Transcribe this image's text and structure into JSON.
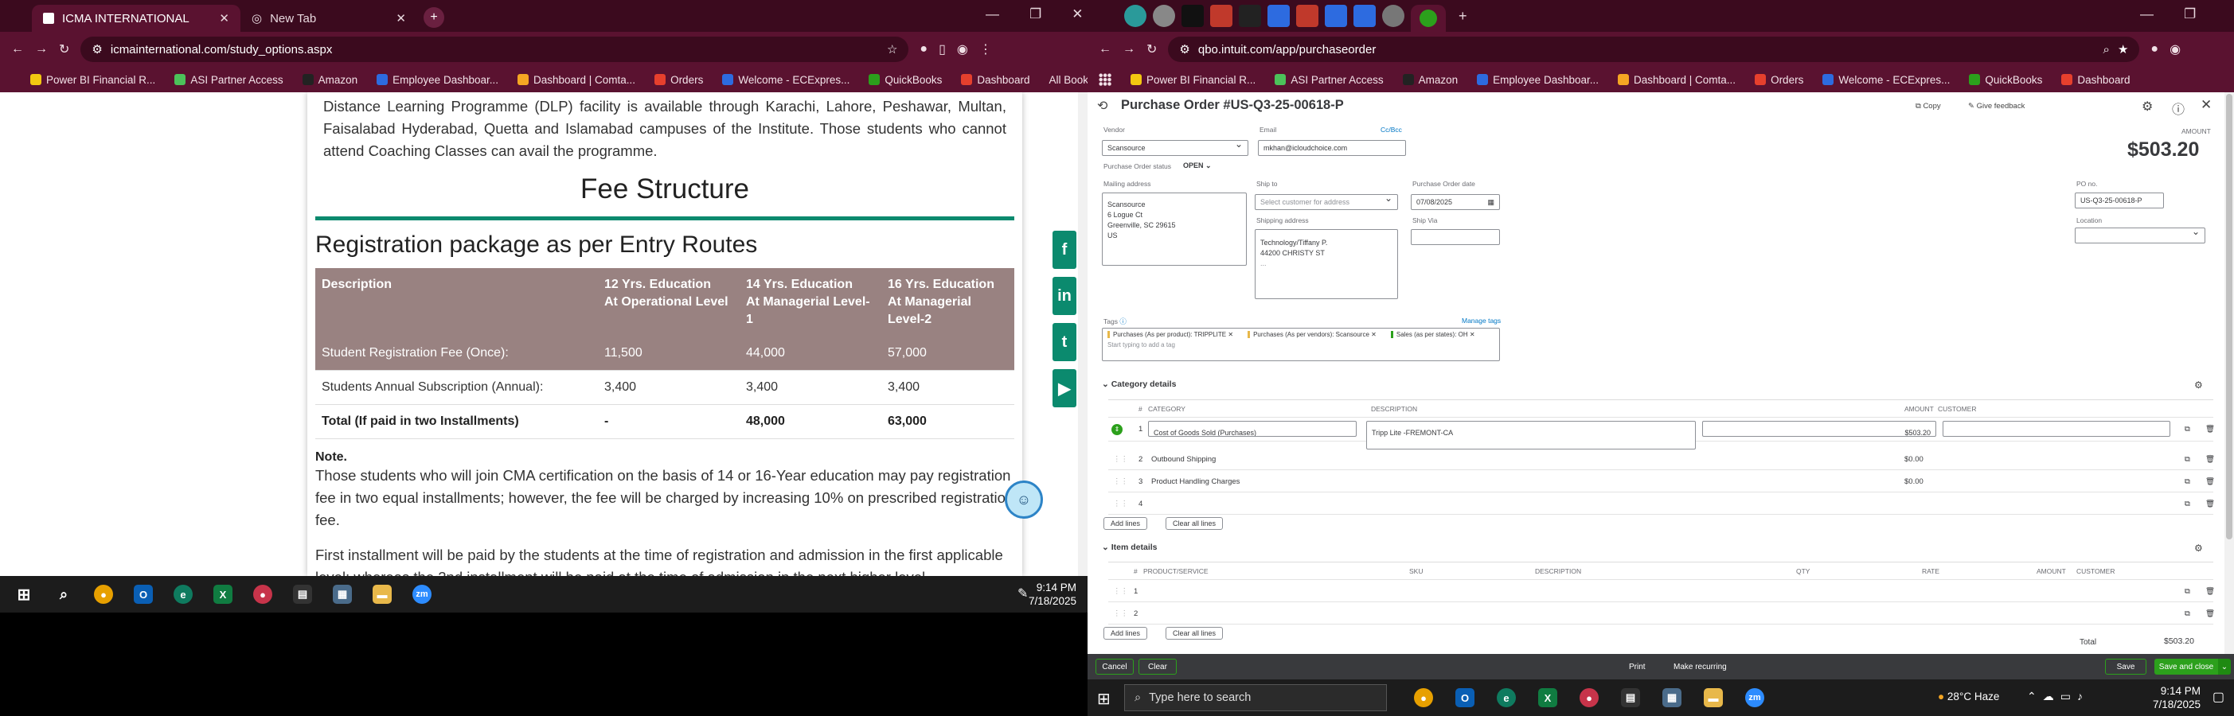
{
  "left_browser": {
    "tabs": [
      {
        "label": "ICMA INTERNATIONAL",
        "active": true
      },
      {
        "label": "New Tab",
        "active": false
      }
    ],
    "url": "icmainternational.com/study_options.aspx",
    "bookmarks": [
      "Power BI Financial R...",
      "ASI Partner Access",
      "Amazon",
      "Employee Dashboar...",
      "Dashboard | Comta...",
      "Orders",
      "Welcome - ECExpres...",
      "QuickBooks",
      "Dashboard"
    ],
    "all_bookmarks": "All Bookmarks",
    "page": {
      "intro": "Distance Learning Programme (DLP) facility is available through Karachi, Lahore, Peshawar, Multan, Faisalabad Hyderabad, Quetta and Islamabad campuses of the Institute. Those students who cannot attend Coaching Classes can avail the programme.",
      "fee_title": "Fee Structure",
      "reg_title": "Registration package as per Entry Routes",
      "table": {
        "headers": [
          [
            "Description",
            ""
          ],
          [
            "12 Yrs. Education",
            "At Operational Level"
          ],
          [
            "14 Yrs. Education",
            "At Managerial Level-1"
          ],
          [
            "16 Yrs. Education",
            "At Managerial Level-2"
          ]
        ],
        "rows": [
          [
            "Student Registration Fee (Once):",
            "11,500",
            "44,000",
            "57,000"
          ],
          [
            "Students Annual Subscription (Annual):",
            "3,400",
            "3,400",
            "3,400"
          ],
          [
            "Total (If paid in two Installments)",
            "-",
            "48,000",
            "63,000"
          ]
        ]
      },
      "note_label": "Note.",
      "note1": "Those students who will join CMA certification on the basis of 14 or 16-Year education may pay registration fee in two equal installments; however, the fee will be charged by increasing 10% on prescribed registration fee.",
      "note2": "First installment will be paid by the students at the time of registration and admission in the first applicable level; whereas the 2nd installment will be paid at the time of admission in the next higher level."
    },
    "taskbar": {
      "time": "9:14 PM",
      "date": "7/18/2025"
    }
  },
  "right_browser": {
    "url": "qbo.intuit.com/app/purchaseorder",
    "bookmarks": [
      "Power BI Financial R...",
      "ASI Partner Access",
      "Amazon",
      "Employee Dashboar...",
      "Dashboard | Comta...",
      "Orders",
      "Welcome - ECExpres...",
      "QuickBooks",
      "Dashboard"
    ],
    "po": {
      "title": "Purchase Order #US-Q3-25-00618-P",
      "copy": "Copy",
      "feedback": "Give feedback",
      "vendor_label": "Vendor",
      "vendor": "Scansource",
      "email_label": "Email",
      "email": "mkhan@icloudchoice.com",
      "ccbcc": "Cc/Bcc",
      "status_label": "Purchase Order status",
      "status": "OPEN",
      "amount_label": "AMOUNT",
      "amount": "$503.20",
      "mailing_label": "Mailing address",
      "mailing": [
        "Scansource",
        "6 Logue Ct",
        "Greenville, SC 29615",
        "US"
      ],
      "shipto_label": "Ship to",
      "shipto_placeholder": "Select customer for address",
      "shipping_label": "Shipping address",
      "shipping": [
        "Technology/Tiffany P.",
        "44200 CHRISTY ST",
        "..."
      ],
      "podate_label": "Purchase Order date",
      "podate": "07/08/2025",
      "shipvia_label": "Ship Via",
      "pono_label": "PO no.",
      "pono": "US-Q3-25-00618-P",
      "location_label": "Location",
      "tags_label": "Tags",
      "manage_tags": "Manage tags",
      "tags": [
        "Purchases (As per product): TRIPPLITE",
        "Purchases (As per vendors): Scansource",
        "Sales (as per states): OH"
      ],
      "tag_placeholder": "Start typing to add a tag",
      "category_header": "Category details",
      "cat_cols": [
        "#",
        "CATEGORY",
        "DESCRIPTION",
        "AMOUNT",
        "CUSTOMER"
      ],
      "cat_rows": [
        {
          "n": "1",
          "category": "Cost of Goods Sold (Purchases)",
          "desc": "Tripp Lite -FREMONT-CA",
          "amount": "$503.20"
        },
        {
          "n": "2",
          "category": "Outbound Shipping",
          "desc": "",
          "amount": "$0.00"
        },
        {
          "n": "3",
          "category": "Product Handling Charges",
          "desc": "",
          "amount": "$0.00"
        },
        {
          "n": "4",
          "category": "",
          "desc": "",
          "amount": ""
        }
      ],
      "add_lines": "Add lines",
      "clear_lines": "Clear all lines",
      "item_header": "Item details",
      "item_cols": [
        "#",
        "PRODUCT/SERVICE",
        "SKU",
        "DESCRIPTION",
        "QTY",
        "RATE",
        "AMOUNT",
        "CUSTOMER"
      ],
      "item_rows": [
        "1",
        "2"
      ],
      "total_label": "Total",
      "total": "$503.20"
    },
    "footer": {
      "cancel": "Cancel",
      "clear": "Clear",
      "print": "Print",
      "recurring": "Make recurring",
      "save": "Save",
      "save_close": "Save and close"
    },
    "taskbar": {
      "search": "Type here to search",
      "weather": "28°C Haze",
      "time": "9:14 PM",
      "date": "7/18/2025"
    }
  }
}
